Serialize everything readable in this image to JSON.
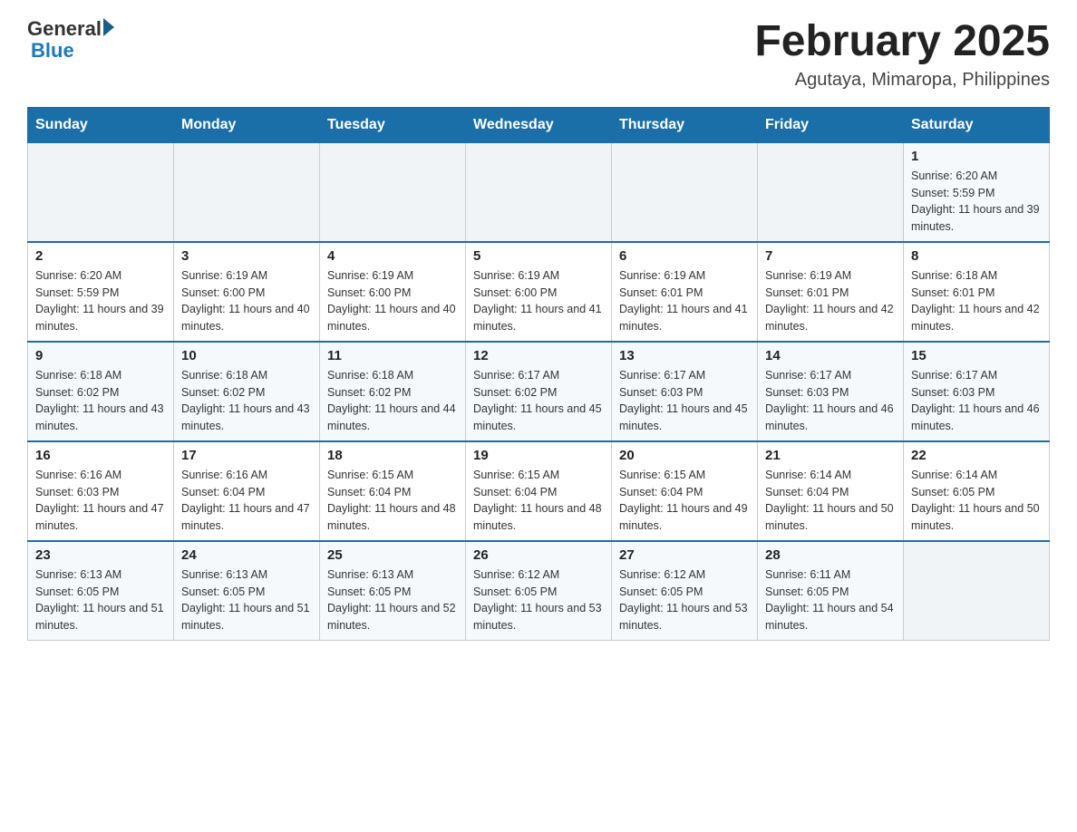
{
  "header": {
    "logo_main": "General",
    "logo_blue": "Blue",
    "title": "February 2025",
    "subtitle": "Agutaya, Mimaropa, Philippines"
  },
  "days_of_week": [
    "Sunday",
    "Monday",
    "Tuesday",
    "Wednesday",
    "Thursday",
    "Friday",
    "Saturday"
  ],
  "weeks": [
    [
      {
        "day": "",
        "info": ""
      },
      {
        "day": "",
        "info": ""
      },
      {
        "day": "",
        "info": ""
      },
      {
        "day": "",
        "info": ""
      },
      {
        "day": "",
        "info": ""
      },
      {
        "day": "",
        "info": ""
      },
      {
        "day": "1",
        "info": "Sunrise: 6:20 AM\nSunset: 5:59 PM\nDaylight: 11 hours and 39 minutes."
      }
    ],
    [
      {
        "day": "2",
        "info": "Sunrise: 6:20 AM\nSunset: 5:59 PM\nDaylight: 11 hours and 39 minutes."
      },
      {
        "day": "3",
        "info": "Sunrise: 6:19 AM\nSunset: 6:00 PM\nDaylight: 11 hours and 40 minutes."
      },
      {
        "day": "4",
        "info": "Sunrise: 6:19 AM\nSunset: 6:00 PM\nDaylight: 11 hours and 40 minutes."
      },
      {
        "day": "5",
        "info": "Sunrise: 6:19 AM\nSunset: 6:00 PM\nDaylight: 11 hours and 41 minutes."
      },
      {
        "day": "6",
        "info": "Sunrise: 6:19 AM\nSunset: 6:01 PM\nDaylight: 11 hours and 41 minutes."
      },
      {
        "day": "7",
        "info": "Sunrise: 6:19 AM\nSunset: 6:01 PM\nDaylight: 11 hours and 42 minutes."
      },
      {
        "day": "8",
        "info": "Sunrise: 6:18 AM\nSunset: 6:01 PM\nDaylight: 11 hours and 42 minutes."
      }
    ],
    [
      {
        "day": "9",
        "info": "Sunrise: 6:18 AM\nSunset: 6:02 PM\nDaylight: 11 hours and 43 minutes."
      },
      {
        "day": "10",
        "info": "Sunrise: 6:18 AM\nSunset: 6:02 PM\nDaylight: 11 hours and 43 minutes."
      },
      {
        "day": "11",
        "info": "Sunrise: 6:18 AM\nSunset: 6:02 PM\nDaylight: 11 hours and 44 minutes."
      },
      {
        "day": "12",
        "info": "Sunrise: 6:17 AM\nSunset: 6:02 PM\nDaylight: 11 hours and 45 minutes."
      },
      {
        "day": "13",
        "info": "Sunrise: 6:17 AM\nSunset: 6:03 PM\nDaylight: 11 hours and 45 minutes."
      },
      {
        "day": "14",
        "info": "Sunrise: 6:17 AM\nSunset: 6:03 PM\nDaylight: 11 hours and 46 minutes."
      },
      {
        "day": "15",
        "info": "Sunrise: 6:17 AM\nSunset: 6:03 PM\nDaylight: 11 hours and 46 minutes."
      }
    ],
    [
      {
        "day": "16",
        "info": "Sunrise: 6:16 AM\nSunset: 6:03 PM\nDaylight: 11 hours and 47 minutes."
      },
      {
        "day": "17",
        "info": "Sunrise: 6:16 AM\nSunset: 6:04 PM\nDaylight: 11 hours and 47 minutes."
      },
      {
        "day": "18",
        "info": "Sunrise: 6:15 AM\nSunset: 6:04 PM\nDaylight: 11 hours and 48 minutes."
      },
      {
        "day": "19",
        "info": "Sunrise: 6:15 AM\nSunset: 6:04 PM\nDaylight: 11 hours and 48 minutes."
      },
      {
        "day": "20",
        "info": "Sunrise: 6:15 AM\nSunset: 6:04 PM\nDaylight: 11 hours and 49 minutes."
      },
      {
        "day": "21",
        "info": "Sunrise: 6:14 AM\nSunset: 6:04 PM\nDaylight: 11 hours and 50 minutes."
      },
      {
        "day": "22",
        "info": "Sunrise: 6:14 AM\nSunset: 6:05 PM\nDaylight: 11 hours and 50 minutes."
      }
    ],
    [
      {
        "day": "23",
        "info": "Sunrise: 6:13 AM\nSunset: 6:05 PM\nDaylight: 11 hours and 51 minutes."
      },
      {
        "day": "24",
        "info": "Sunrise: 6:13 AM\nSunset: 6:05 PM\nDaylight: 11 hours and 51 minutes."
      },
      {
        "day": "25",
        "info": "Sunrise: 6:13 AM\nSunset: 6:05 PM\nDaylight: 11 hours and 52 minutes."
      },
      {
        "day": "26",
        "info": "Sunrise: 6:12 AM\nSunset: 6:05 PM\nDaylight: 11 hours and 53 minutes."
      },
      {
        "day": "27",
        "info": "Sunrise: 6:12 AM\nSunset: 6:05 PM\nDaylight: 11 hours and 53 minutes."
      },
      {
        "day": "28",
        "info": "Sunrise: 6:11 AM\nSunset: 6:05 PM\nDaylight: 11 hours and 54 minutes."
      },
      {
        "day": "",
        "info": ""
      }
    ]
  ]
}
